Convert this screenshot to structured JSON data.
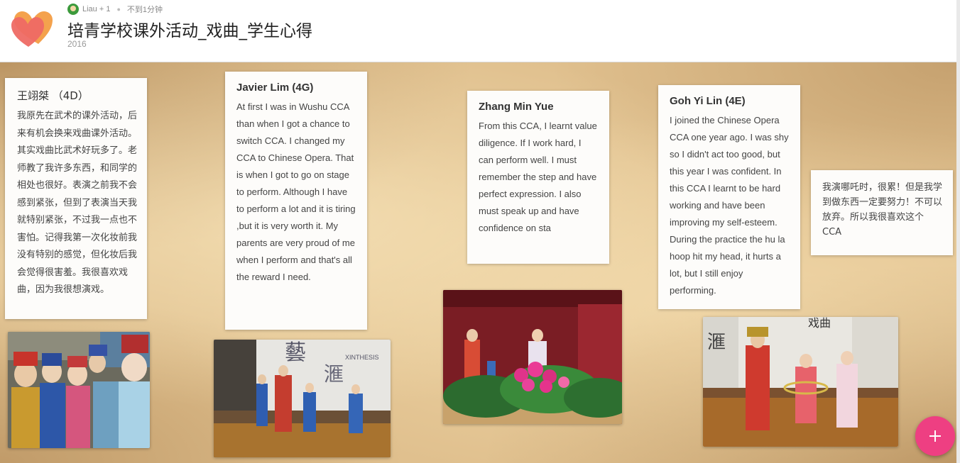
{
  "header": {
    "author": "Liau + 1",
    "time_ago": "不到1分钟",
    "title": "培青学校课外活动_戏曲_学生心得",
    "year": "2016",
    "logo_color": "#f07c4f"
  },
  "posts": [
    {
      "title": "王翊桀 （4D）",
      "body": "我原先在武术的课外活动，后来有机会换来戏曲课外活动。其实戏曲比武术好玩多了。老师教了我许多东西，和同学的相处也很好。表演之前我不会感到紧张，但到了表演当天我就特别紧张，不过我一点也不害怕。记得我第一次化妆前我没有特别的感觉，但化妆后我会觉得很害羞。我很喜欢戏曲，因为我很想演戏。"
    },
    {
      "title": "Javier Lim (4G)",
      "body": "At first I was in Wushu CCA than when I got a chance to switch CCA. I changed my CCA to Chinese Opera. That is when I got to go on stage to perform. Although I have to perform a lot and it is tiring ,but it is very worth it. My parents are very proud of me when I perform and that's all the reward I need."
    },
    {
      "title": "Zhang Min Yue",
      "body": "From this CCA, I learnt value diligence. If I work hard, I can perform well. I must remember the step and have perfect expression. I also must speak up and have confidence on sta"
    },
    {
      "title": "Goh Yi Lin (4E)",
      "body": "I joined the Chinese Opera CCA one year ago. I was shy so I didn't act too good, but this year I was confident. In this CCA I learnt to be hard working and have been improving my self-esteem. During the practice the hu la hoop hit my head, it hurts a lot, but I still enjoy performing."
    },
    {
      "title": "",
      "body": "我演哪吒时，很累！但是我学到做东西一定要努力！不可以放弃。所以我很喜欢这个CCA"
    }
  ],
  "photo_texts": {
    "banner_a": "藝",
    "banner_b": "滙",
    "banner_c": "XINTHESIS",
    "banner_d": "戏曲",
    "banner_e": "滙"
  },
  "fab": {
    "icon": "plus-icon",
    "color": "#ee3f82"
  }
}
